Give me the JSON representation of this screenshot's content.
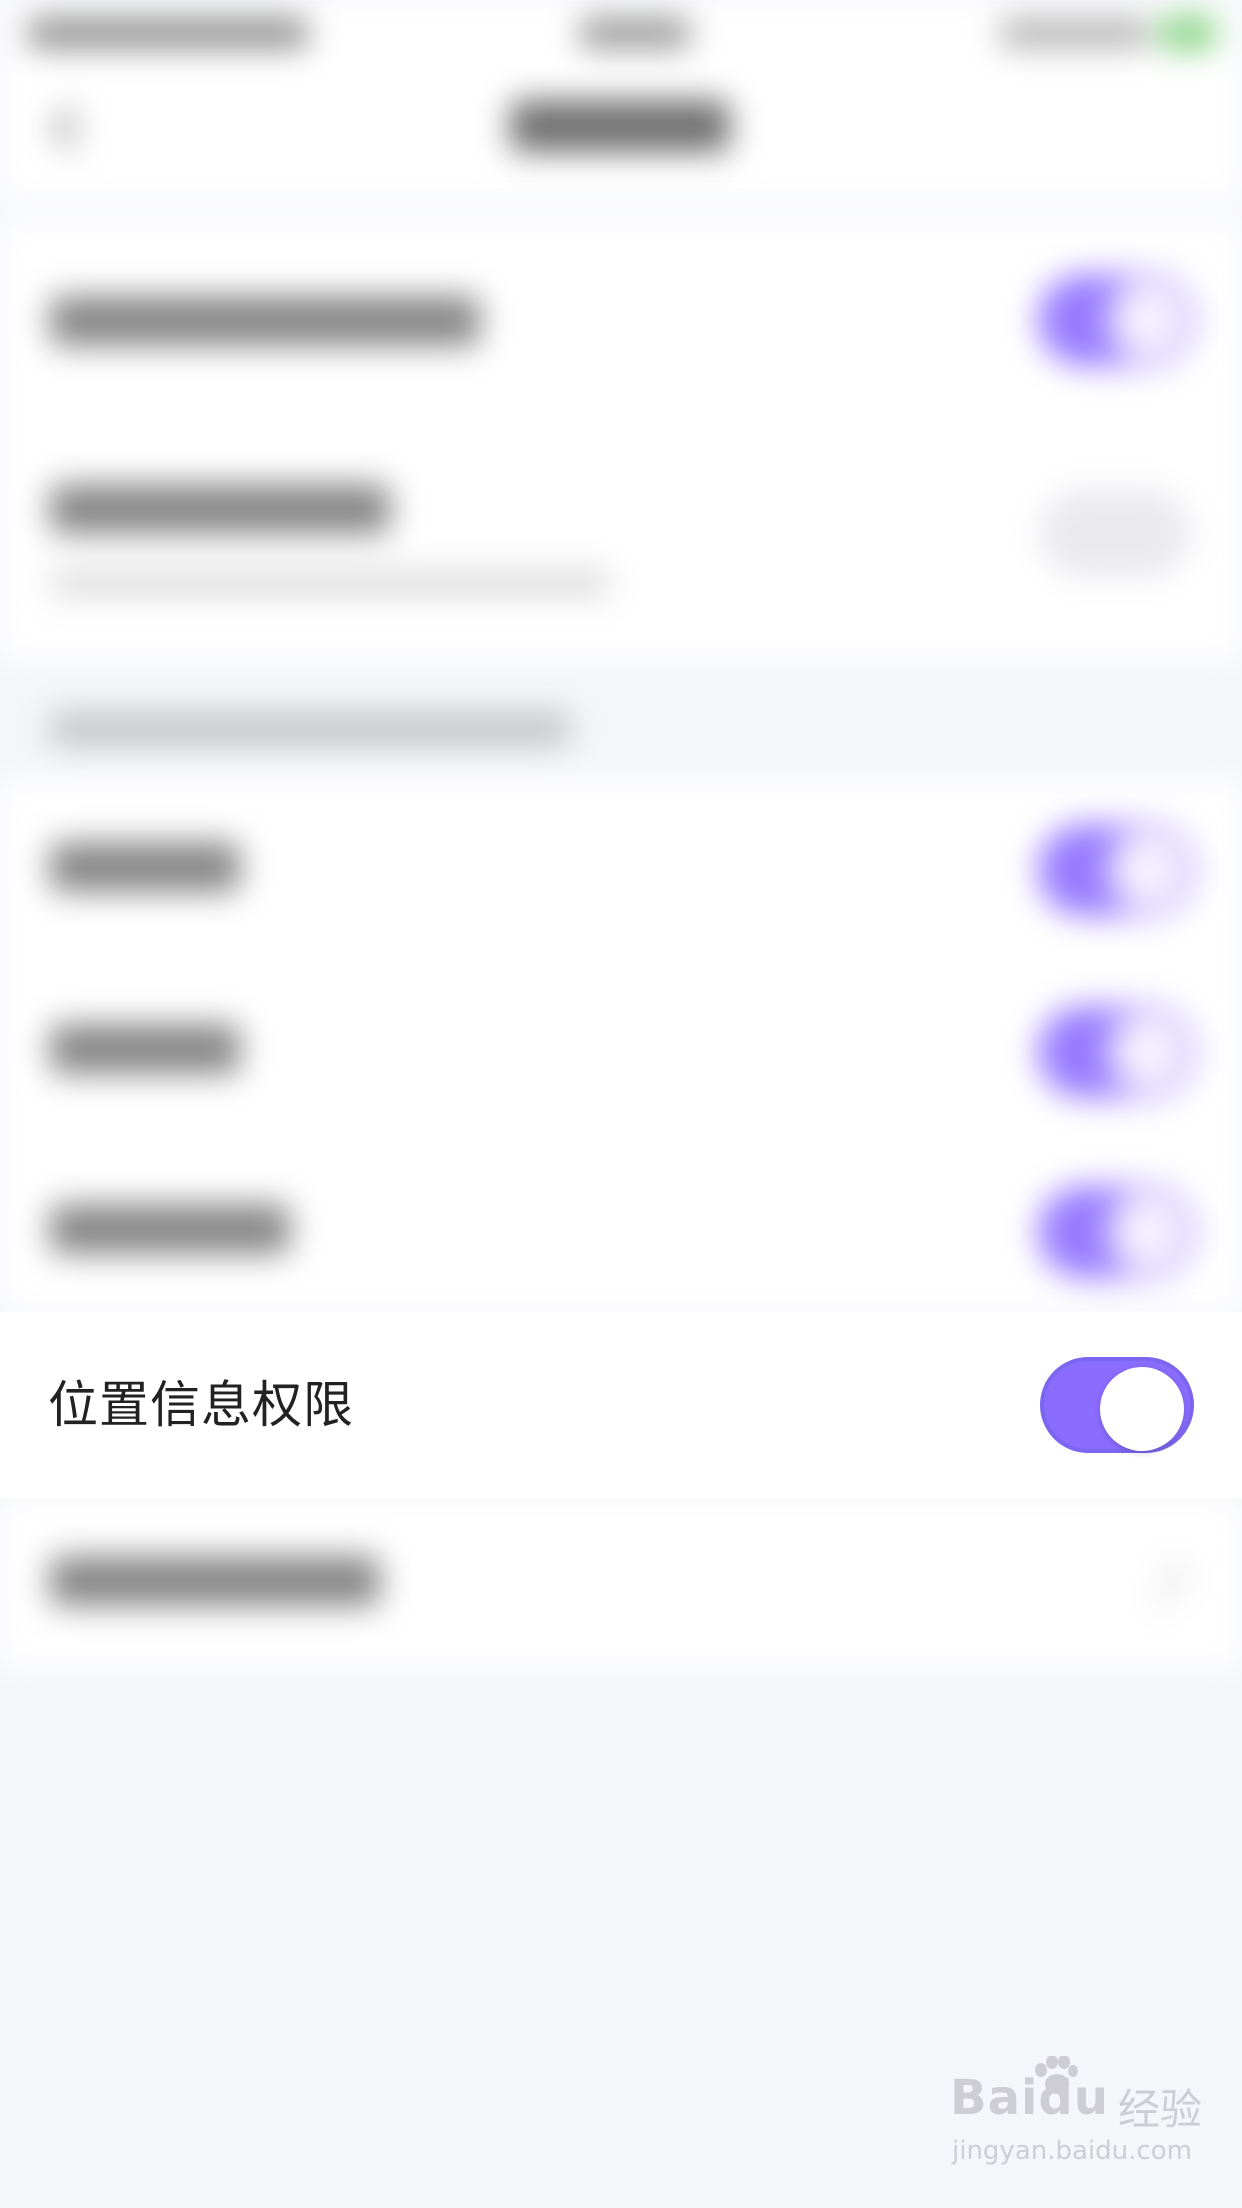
{
  "setting": {
    "location_permission_label": "位置信息权限",
    "location_permission_enabled": true
  },
  "watermark": {
    "brand": "Baidu",
    "brand_cn": "经验",
    "url": "jingyan.baidu.com"
  },
  "colors": {
    "accent": "#8a6cff",
    "toggle_border": "#7c66ef",
    "page_background": "#f5f6fa",
    "card_background": "#ffffff"
  },
  "icons": {
    "back": "back-arrow-icon",
    "watermark_paw": "paw-icon"
  }
}
